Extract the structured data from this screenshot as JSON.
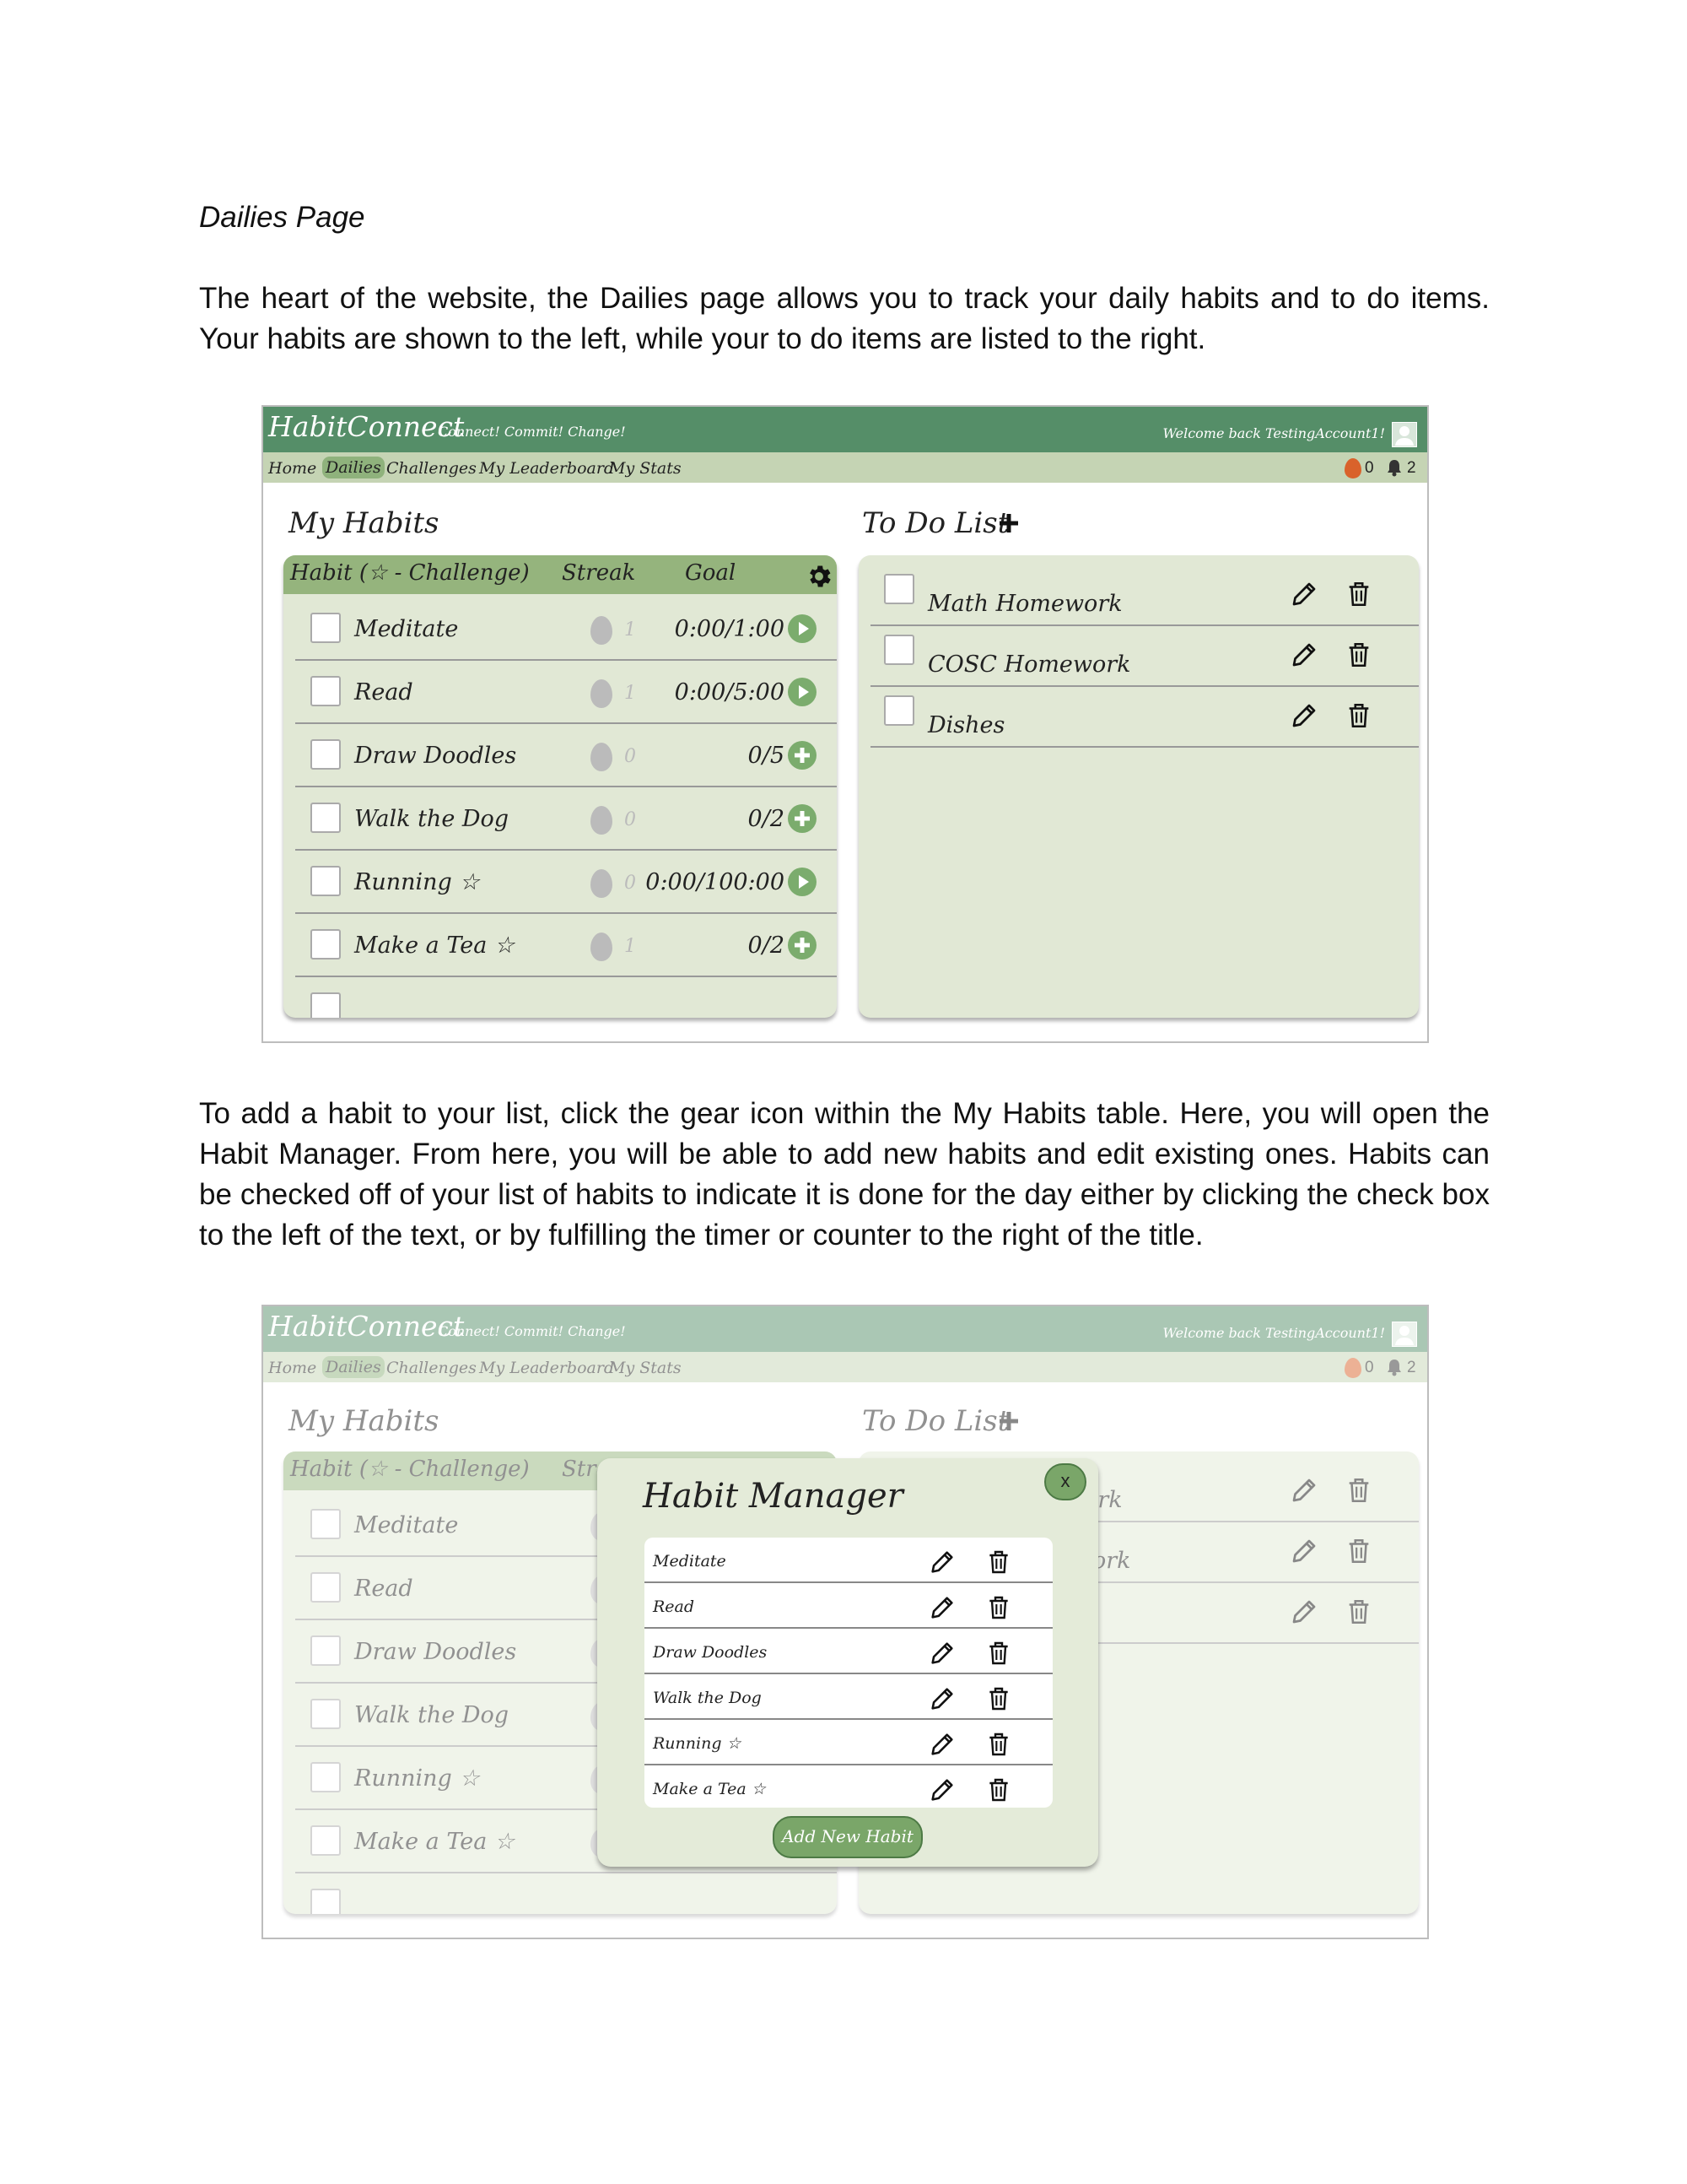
{
  "doc": {
    "section_title": "Dailies Page",
    "paragraph1": "The heart of the website, the Dailies page allows you to track your daily habits and to do items. Your habits are shown to the left, while your to do items are listed to the right.",
    "paragraph2": "To add a habit to your list, click the gear icon within the My Habits table. Here, you will open the Habit Manager. From here, you will be able to add new habits and edit existing ones. Habits can be checked off of your list of habits to indicate it is done for the day either by clicking the check box to the left of the text, or by fulfilling the timer or counter to the right of the title."
  },
  "app": {
    "brand": "HabitConnect",
    "tagline": "Connect! Commit! Change!",
    "welcome": "Welcome back TestingAccount1!",
    "nav": [
      "Home",
      "Dailies",
      "Challenges",
      "My Leaderboard",
      "My Stats"
    ],
    "flame_count": "0",
    "notif_count": "2",
    "colors": {
      "header": "#558e68",
      "nav": "#c5d4b4",
      "panel": "#e1e8d5",
      "accent": "#7bac6d"
    }
  },
  "habits": {
    "title": "My Habits",
    "col_habit": "Habit (☆ - Challenge)",
    "col_streak": "Streak",
    "col_goal": "Goal",
    "rows": [
      {
        "name": "Meditate",
        "streak": "1",
        "goal": "0:00/1:00",
        "action": "play"
      },
      {
        "name": "Read",
        "streak": "1",
        "goal": "0:00/5:00",
        "action": "play"
      },
      {
        "name": "Draw Doodles",
        "streak": "0",
        "goal": "0/5",
        "action": "plus"
      },
      {
        "name": "Walk the Dog",
        "streak": "0",
        "goal": "0/2",
        "action": "plus"
      },
      {
        "name": "Running ☆",
        "streak": "0",
        "goal": "0:00/100:00",
        "action": "play"
      },
      {
        "name": "Make a Tea ☆",
        "streak": "1",
        "goal": "0/2",
        "action": "plus"
      }
    ]
  },
  "todo": {
    "title": "To Do List",
    "items": [
      "Math Homework",
      "COSC Homework",
      "Dishes"
    ]
  },
  "modal": {
    "title": "Habit Manager",
    "close_label": "x",
    "items": [
      "Meditate",
      "Read",
      "Draw Doodles",
      "Walk the Dog",
      "Running ☆",
      "Make a Tea ☆"
    ],
    "add_button": "Add New Habit"
  }
}
